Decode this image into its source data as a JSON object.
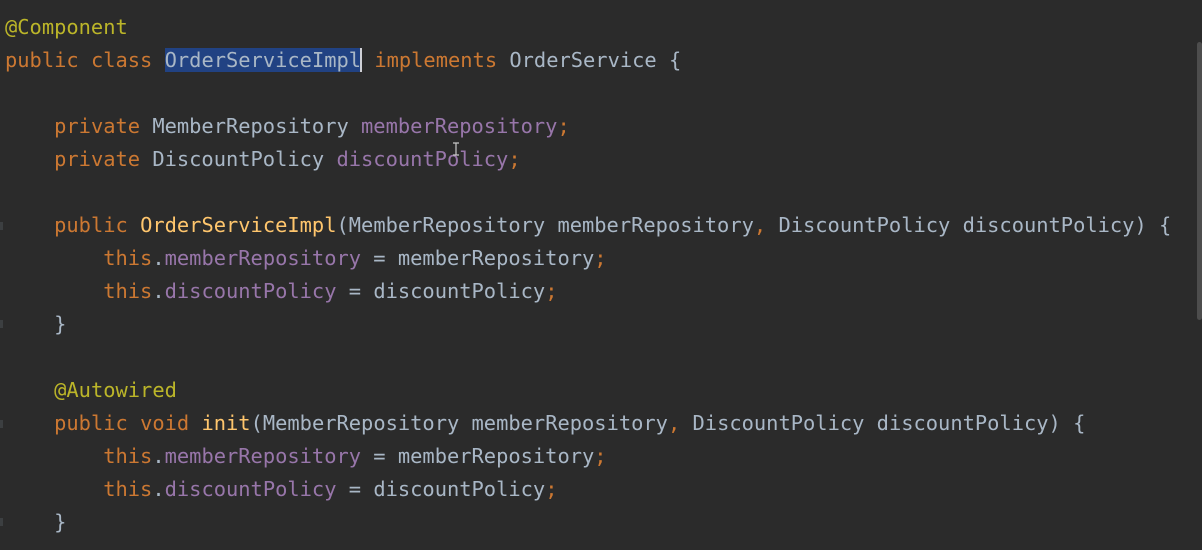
{
  "editor": {
    "language": "java",
    "selected_text": "OrderServiceImpl",
    "lines": [
      {
        "tokens": [
          {
            "text": "@Component",
            "kind": "anno"
          }
        ]
      },
      {
        "tokens": [
          {
            "text": "public",
            "kind": "kw"
          },
          {
            "text": " ",
            "kind": "plain"
          },
          {
            "text": "class",
            "kind": "kw"
          },
          {
            "text": " ",
            "kind": "plain"
          },
          {
            "text": "OrderServiceImpl",
            "kind": "sel"
          },
          {
            "text": "",
            "kind": "caret"
          },
          {
            "text": " ",
            "kind": "plain"
          },
          {
            "text": "implements",
            "kind": "kw"
          },
          {
            "text": " OrderService {",
            "kind": "plain"
          }
        ]
      },
      {
        "tokens": []
      },
      {
        "tokens": [
          {
            "text": "    ",
            "kind": "plain"
          },
          {
            "text": "private",
            "kind": "kw"
          },
          {
            "text": " MemberRepository ",
            "kind": "plain"
          },
          {
            "text": "memberRepository",
            "kind": "field"
          },
          {
            "text": ";",
            "kind": "kw"
          }
        ]
      },
      {
        "tokens": [
          {
            "text": "    ",
            "kind": "plain"
          },
          {
            "text": "private",
            "kind": "kw"
          },
          {
            "text": " DiscountPolicy ",
            "kind": "plain"
          },
          {
            "text": "discountPolicy",
            "kind": "field"
          },
          {
            "text": ";",
            "kind": "kw"
          }
        ]
      },
      {
        "tokens": []
      },
      {
        "tokens": [
          {
            "text": "    ",
            "kind": "plain"
          },
          {
            "text": "public",
            "kind": "kw"
          },
          {
            "text": " ",
            "kind": "plain"
          },
          {
            "text": "OrderServiceImpl",
            "kind": "method"
          },
          {
            "text": "(MemberRepository memberRepository",
            "kind": "plain"
          },
          {
            "text": ",",
            "kind": "kw"
          },
          {
            "text": " DiscountPolicy discountPolicy) {",
            "kind": "plain"
          }
        ]
      },
      {
        "tokens": [
          {
            "text": "        ",
            "kind": "plain"
          },
          {
            "text": "this",
            "kind": "kw"
          },
          {
            "text": ".",
            "kind": "plain"
          },
          {
            "text": "memberRepository",
            "kind": "field"
          },
          {
            "text": " = memberRepository",
            "kind": "plain"
          },
          {
            "text": ";",
            "kind": "kw"
          }
        ]
      },
      {
        "tokens": [
          {
            "text": "        ",
            "kind": "plain"
          },
          {
            "text": "this",
            "kind": "kw"
          },
          {
            "text": ".",
            "kind": "plain"
          },
          {
            "text": "discountPolicy",
            "kind": "field"
          },
          {
            "text": " = discountPolicy",
            "kind": "plain"
          },
          {
            "text": ";",
            "kind": "kw"
          }
        ]
      },
      {
        "tokens": [
          {
            "text": "    }",
            "kind": "plain"
          }
        ]
      },
      {
        "tokens": []
      },
      {
        "tokens": [
          {
            "text": "    ",
            "kind": "plain"
          },
          {
            "text": "@Autowired",
            "kind": "anno"
          }
        ]
      },
      {
        "tokens": [
          {
            "text": "    ",
            "kind": "plain"
          },
          {
            "text": "public",
            "kind": "kw"
          },
          {
            "text": " ",
            "kind": "plain"
          },
          {
            "text": "void",
            "kind": "kw"
          },
          {
            "text": " ",
            "kind": "plain"
          },
          {
            "text": "init",
            "kind": "method"
          },
          {
            "text": "(MemberRepository memberRepository",
            "kind": "plain"
          },
          {
            "text": ",",
            "kind": "kw"
          },
          {
            "text": " DiscountPolicy discountPolicy) {",
            "kind": "plain"
          }
        ]
      },
      {
        "tokens": [
          {
            "text": "        ",
            "kind": "plain"
          },
          {
            "text": "this",
            "kind": "kw"
          },
          {
            "text": ".",
            "kind": "plain"
          },
          {
            "text": "memberRepository",
            "kind": "field"
          },
          {
            "text": " = memberRepository",
            "kind": "plain"
          },
          {
            "text": ";",
            "kind": "kw"
          }
        ]
      },
      {
        "tokens": [
          {
            "text": "        ",
            "kind": "plain"
          },
          {
            "text": "this",
            "kind": "kw"
          },
          {
            "text": ".",
            "kind": "plain"
          },
          {
            "text": "discountPolicy",
            "kind": "field"
          },
          {
            "text": " = discountPolicy",
            "kind": "plain"
          },
          {
            "text": ";",
            "kind": "kw"
          }
        ]
      },
      {
        "tokens": [
          {
            "text": "    }",
            "kind": "plain"
          }
        ]
      }
    ]
  },
  "colors": {
    "background": "#2b2b2b",
    "annotation": "#bbb529",
    "keyword": "#cc7832",
    "field": "#9876aa",
    "method": "#ffc66d",
    "plain": "#a9b7c6",
    "selection": "#214283"
  },
  "icons": {
    "mouse_cursor": "text-cursor-icon"
  }
}
